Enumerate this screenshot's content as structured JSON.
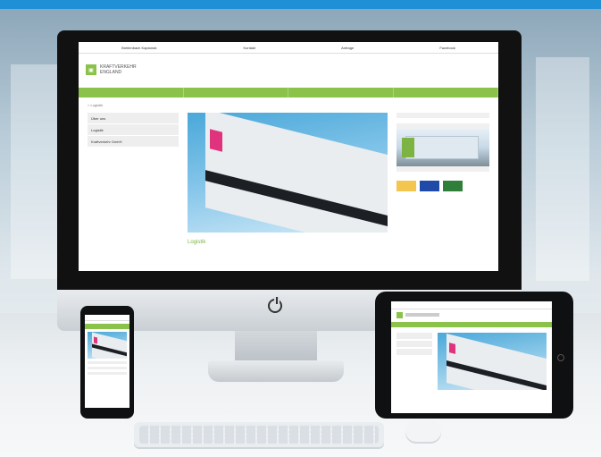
{
  "site": {
    "top_links": [
      "Breitenbach Kaplanstr.",
      "Kontakt",
      "Anfrage",
      "Facebook"
    ],
    "logo_text_line1": "KRAFTVERKEHR",
    "logo_text_line2": "ENGLAND",
    "nav": [
      "",
      "",
      "",
      ""
    ],
    "breadcrumb": "Logistik",
    "sidebar": [
      "Über uns",
      "Logistik",
      "Kraftverkehr GmbH"
    ],
    "hero_headline": "Logistik",
    "hero_paragraph": "",
    "right_title_1": "",
    "right_text_1": "",
    "right_title_2": "",
    "right_title_3": ""
  },
  "colors": {
    "accent": "#8bc34a",
    "brand_pink": "#e0337e",
    "sky_blue": "#4aa8d9"
  }
}
